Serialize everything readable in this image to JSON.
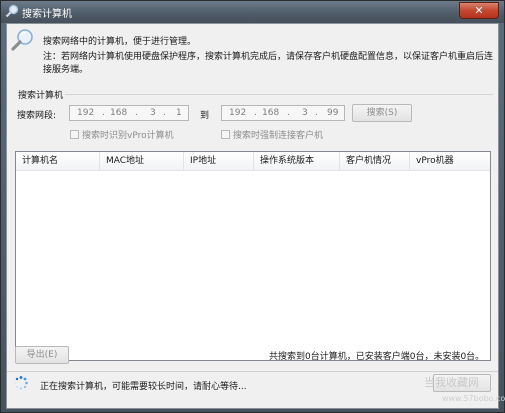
{
  "window": {
    "title": "搜索计算机",
    "close_glyph": "✕"
  },
  "header": {
    "intro": "搜索网络中的计算机，便于进行管理。",
    "note": "注：若网络内计算机使用硬盘保护程序，搜索计算机完成后，请保存客户机硬盘配置信息，以保证客户机重启后连接服务端。"
  },
  "search_group": {
    "title": "搜索计算机",
    "segment_label": "搜索网段:",
    "to_label": "到",
    "start_ip": [
      "192",
      "168",
      "3",
      "1"
    ],
    "end_ip": [
      "192",
      "168",
      "3",
      "99"
    ],
    "search_button": "搜索(S)",
    "vpro_checkbox": "搜索时识别vPro计算机",
    "force_checkbox": "搜索时强制连接客户机"
  },
  "table": {
    "columns": [
      "计算机名",
      "MAC地址",
      "IP地址",
      "操作系统版本",
      "客户机情况",
      "vPro机器"
    ],
    "rows": []
  },
  "footer": {
    "export_button": "导出(E)",
    "summary": "共搜索到0台计算机，已安装客户端0台，未安装0台。",
    "status": "正在搜索计算机，可能需要较长时间，请耐心等待...",
    "watermark": "当我收藏网",
    "watermark_url": "www.57bobo.com"
  },
  "colors": {
    "titlebar": "#4e5a66",
    "close": "#c4462f",
    "panel": "#f0f0f0"
  }
}
